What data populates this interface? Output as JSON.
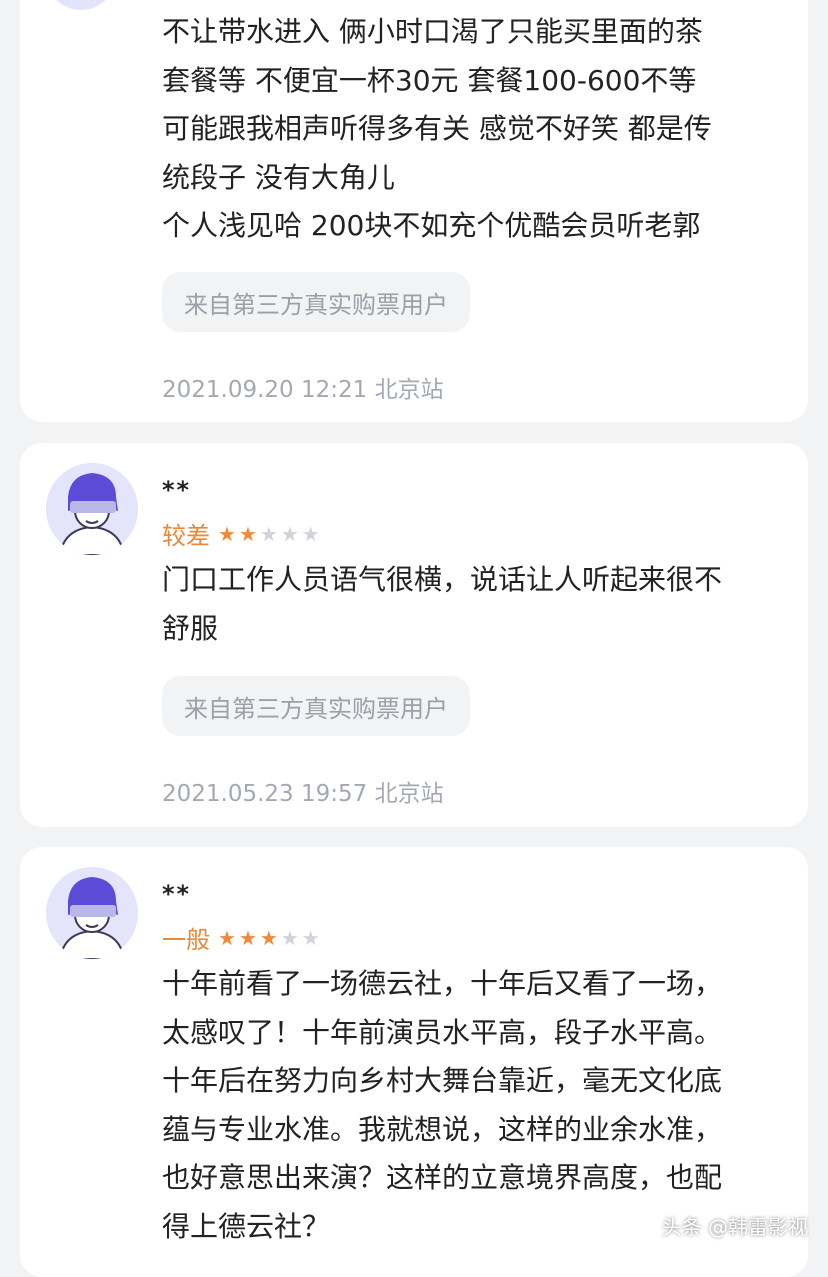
{
  "reviews": [
    {
      "content_lines": [
        "不让带水进入 俩小时口渴了只能买里面的茶",
        "套餐等 不便宜一杯30元 套餐100-600不等",
        "可能跟我相声听得多有关 感觉不好笑 都是传",
        "统段子 没有大角儿",
        "个人浅见哈 200块不如充个优酷会员听老郭"
      ],
      "source_tag": "来自第三方真实购票用户",
      "meta": "2021.09.20 12:21 北京站"
    },
    {
      "username": "**",
      "rating_label": "较差",
      "rating": 2,
      "content_lines": [
        "门口工作人员语气很横，说话让人听起来很不",
        "舒服"
      ],
      "source_tag": "来自第三方真实购票用户",
      "meta": "2021.05.23 19:57 北京站"
    },
    {
      "username": "**",
      "rating_label": "一般",
      "rating": 3,
      "content_lines": [
        "十年前看了一场德云社，十年后又看了一场，",
        "太感叹了！十年前演员水平高，段子水平高。",
        "十年后在努力向乡村大舞台靠近，毫无文化底",
        "蕴与专业水准。我就想说，这样的业余水准，",
        "也好意思出来演？这样的立意境界高度，也配",
        "得上德云社？"
      ]
    }
  ],
  "watermark": "头条 @韩雷影视",
  "colors": {
    "background": "#f2f3f5",
    "card": "#ffffff",
    "rating_orange": "#e8883a",
    "star_off": "#d0d3d9",
    "tag_text": "#9aa0a8",
    "meta_text": "#a4a9b1"
  },
  "icons": {
    "avatar": "user-avatar-icon",
    "star": "star-icon"
  }
}
